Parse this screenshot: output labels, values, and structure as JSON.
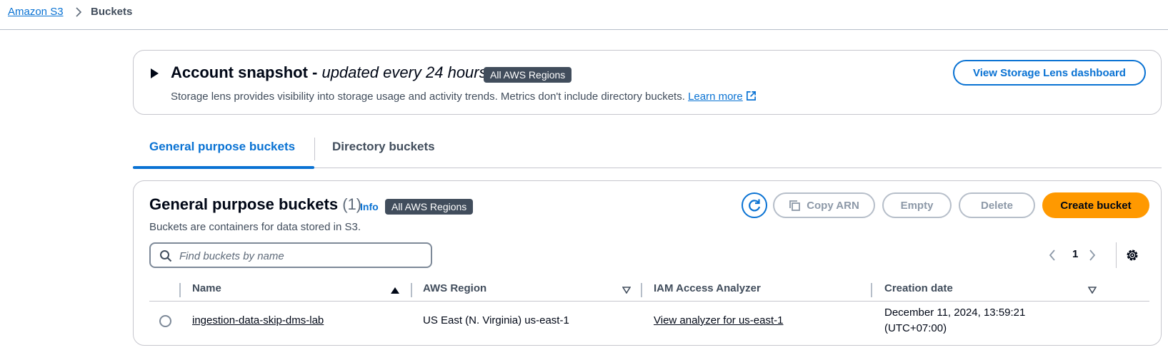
{
  "breadcrumb": {
    "root": "Amazon S3",
    "current": "Buckets"
  },
  "snapshot": {
    "title": "Account snapshot - ",
    "title_italic": "updated every 24 hours",
    "badge": "All AWS Regions",
    "description": "Storage lens provides visibility into storage usage and activity trends. Metrics don't include directory buckets.",
    "learn_more": "Learn more",
    "dashboard_button": "View Storage Lens dashboard"
  },
  "tabs": [
    {
      "label": "General purpose buckets",
      "active": true
    },
    {
      "label": "Directory buckets",
      "active": false
    }
  ],
  "buckets_panel": {
    "title": "General purpose buckets",
    "count": "(1)",
    "info": "Info",
    "badge": "All AWS Regions",
    "description": "Buckets are containers for data stored in S3.",
    "actions": {
      "copy_arn": "Copy ARN",
      "empty": "Empty",
      "delete": "Delete",
      "create": "Create bucket"
    },
    "search_placeholder": "Find buckets by name",
    "page": "1",
    "columns": [
      "Name",
      "AWS Region",
      "IAM Access Analyzer",
      "Creation date"
    ],
    "rows": [
      {
        "name": "ingestion-data-skip-dms-lab",
        "region": "US East (N. Virginia) us-east-1",
        "analyzer": "View analyzer for us-east-1",
        "created_line1": "December 11, 2024, 13:59:21",
        "created_line2": "(UTC+07:00)"
      }
    ]
  },
  "colors": {
    "link": "#0972d3",
    "primary": "#ff9900",
    "badge": "#414d5c"
  }
}
